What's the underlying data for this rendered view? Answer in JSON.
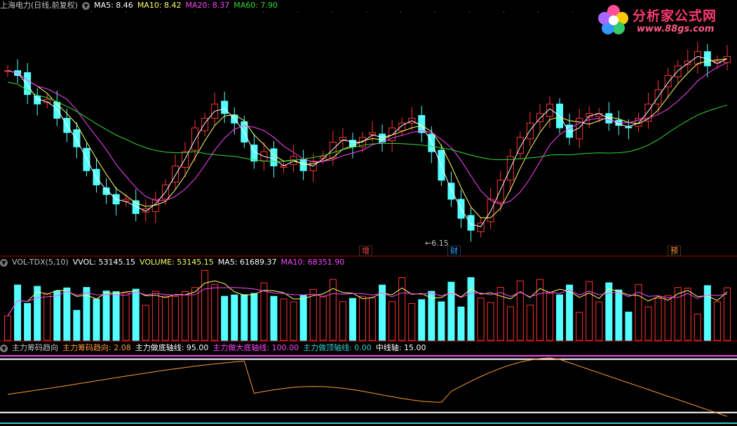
{
  "main_panel": {
    "title": "上海电力(日线,前复权)",
    "ma": [
      {
        "label": "MA5: 8.46",
        "color": "#ffffff"
      },
      {
        "label": "MA10: 8.42",
        "color": "#ffff66"
      },
      {
        "label": "MA20: 8.37",
        "color": "#ff44ff"
      },
      {
        "label": "MA60: 7.90",
        "color": "#33dd33"
      }
    ],
    "low_marker": "←6.15",
    "event_tags": [
      {
        "label": "增",
        "color": "#ff4444"
      },
      {
        "label": "财",
        "color": "#33aaff"
      },
      {
        "label": "预",
        "color": "#ff9933"
      }
    ]
  },
  "volume_panel": {
    "title": "VOL-TDX(5,10)",
    "items": [
      {
        "label": "VVOL: 53145.15",
        "color": "#ffffff"
      },
      {
        "label": "VOLUME: 53145.15",
        "color": "#ffff66"
      },
      {
        "label": "MA5: 61689.37",
        "color": "#ffffff"
      },
      {
        "label": "MA10: 68351.90",
        "color": "#ff44ff"
      }
    ]
  },
  "indicator_panel": {
    "title": "主力筹码趋向",
    "items": [
      {
        "label": "主力筹码趋向: 2.08",
        "color": "#ff9933"
      },
      {
        "label": "主力做底轴线: 95.00",
        "color": "#ffffff"
      },
      {
        "label": "主力做大底轴线: 100.00",
        "color": "#ff44ff"
      },
      {
        "label": "主力做顶轴线: 0.00",
        "color": "#33cccc"
      },
      {
        "label": "中线轴: 15.00",
        "color": "#ffffff"
      }
    ]
  },
  "watermark": {
    "title": "分析家公式网",
    "url": "www.88gs.com"
  },
  "colors": {
    "up": "#ff3333",
    "down": "#55ffff",
    "ma5": "#ffffff",
    "ma10": "#ffff66",
    "ma20": "#ff44ff",
    "ma60": "#33dd33",
    "trend": "#ff9933"
  },
  "chart_data": {
    "type": "candlestick",
    "close": [
      9.6,
      9.5,
      9.1,
      8.9,
      9.0,
      8.6,
      8.3,
      8.0,
      7.5,
      7.2,
      7.0,
      6.8,
      6.9,
      6.6,
      6.7,
      6.9,
      7.2,
      7.6,
      7.9,
      8.4,
      8.6,
      8.9,
      8.7,
      8.5,
      8.1,
      7.7,
      7.9,
      7.6,
      7.6,
      7.8,
      7.5,
      7.7,
      7.8,
      8.1,
      8.2,
      8.0,
      8.2,
      8.3,
      8.1,
      8.4,
      8.5,
      8.6,
      8.3,
      7.9,
      7.3,
      6.9,
      6.5,
      6.25,
      6.4,
      6.9,
      7.3,
      7.8,
      8.2,
      8.5,
      8.7,
      8.9,
      8.4,
      8.2,
      8.6,
      8.7,
      8.7,
      8.5,
      8.45,
      8.4,
      8.6,
      8.9,
      9.2,
      9.5,
      9.7,
      9.8,
      10.0,
      9.7,
      9.8,
      9.9
    ]
  }
}
